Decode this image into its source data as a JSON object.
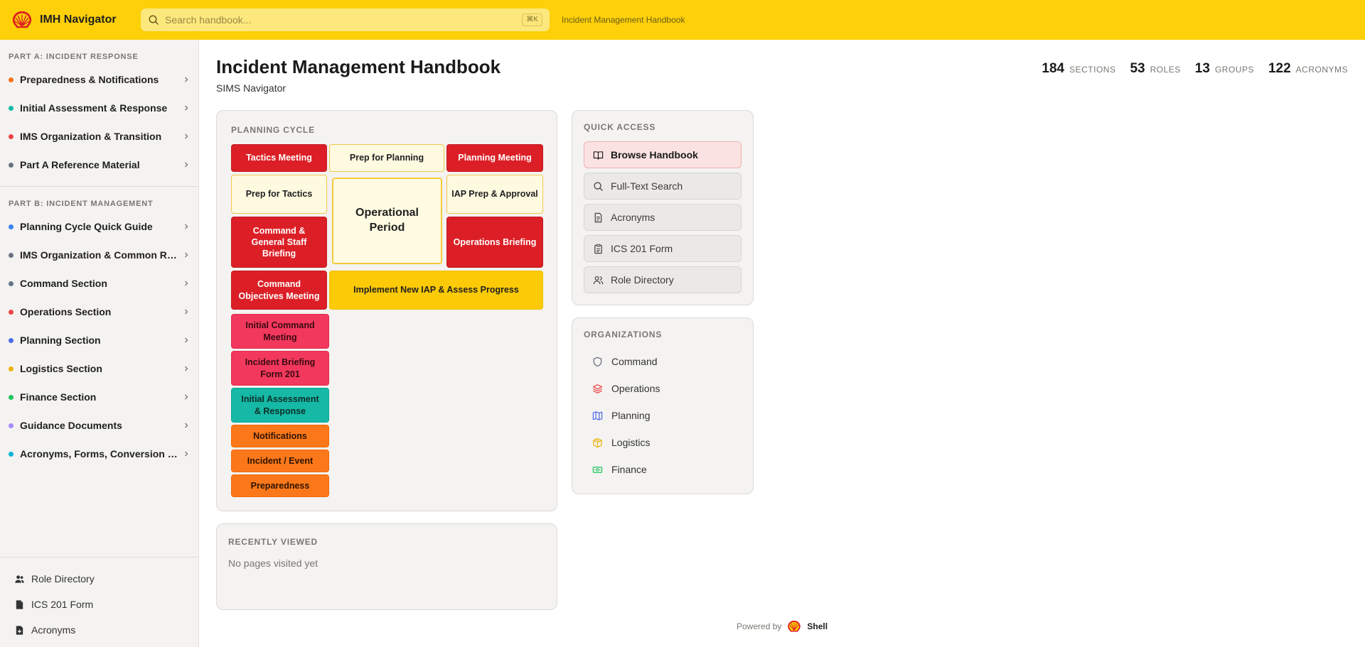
{
  "app": {
    "name": "IMH Navigator",
    "breadcrumb": "Incident Management Handbook"
  },
  "search": {
    "placeholder": "Search handbook...",
    "shortcut": "⌘K"
  },
  "sidebar": {
    "part_a_title": "PART A: INCIDENT RESPONSE",
    "part_a": [
      {
        "label": "Preparedness & Notifications",
        "color": "#f97316"
      },
      {
        "label": "Initial Assessment & Response",
        "color": "#14b8a6"
      },
      {
        "label": "IMS Organization & Transition",
        "color": "#ef4444"
      },
      {
        "label": "Part A Reference Material",
        "color": "#6b7280"
      }
    ],
    "part_b_title": "PART B: INCIDENT MANAGEMENT",
    "part_b": [
      {
        "label": "Planning Cycle Quick Guide",
        "color": "#3b82f6"
      },
      {
        "label": "IMS Organization & Common Re...",
        "color": "#6b7280"
      },
      {
        "label": "Command Section",
        "color": "#64748b"
      },
      {
        "label": "Operations Section",
        "color": "#ef4444"
      },
      {
        "label": "Planning Section",
        "color": "#4f6bed"
      },
      {
        "label": "Logistics Section",
        "color": "#eab308"
      },
      {
        "label": "Finance Section",
        "color": "#22c55e"
      },
      {
        "label": "Guidance Documents",
        "color": "#a78bfa"
      },
      {
        "label": "Acronyms, Forms, Conversion Ta...",
        "color": "#06b6d4"
      }
    ],
    "bottom": [
      {
        "label": "Role Directory",
        "icon": "users-icon"
      },
      {
        "label": "ICS 201 Form",
        "icon": "document-icon"
      },
      {
        "label": "Acronyms",
        "icon": "file-plus-icon"
      }
    ]
  },
  "header": {
    "title": "Incident Management Handbook",
    "subtitle": "SIMS Navigator",
    "stats": [
      {
        "value": "184",
        "label": "SECTIONS"
      },
      {
        "value": "53",
        "label": "ROLES"
      },
      {
        "value": "13",
        "label": "GROUPS"
      },
      {
        "value": "122",
        "label": "ACRONYMS"
      }
    ]
  },
  "planning_cycle": {
    "title": "PLANNING CYCLE",
    "tactics_meeting": "Tactics Meeting",
    "prep_for_planning": "Prep for Planning",
    "planning_meeting": "Planning Meeting",
    "prep_for_tactics": "Prep for Tactics",
    "operational_period": "Operational Period",
    "iap_prep": "IAP Prep & Approval",
    "cgs_briefing": "Command & General Staff Briefing",
    "operations_briefing": "Operations Briefing",
    "command_objectives": "Command Objectives Meeting",
    "implement_iap": "Implement New IAP & Assess Progress",
    "initial_command": "Initial Command Meeting",
    "incident_briefing": "Incident Briefing Form 201",
    "initial_assessment": "Initial Assessment & Response",
    "notifications": "Notifications",
    "incident_event": "Incident / Event",
    "preparedness": "Preparedness"
  },
  "recently_viewed": {
    "title": "RECENTLY VIEWED",
    "empty": "No pages visited yet"
  },
  "quick_access": {
    "title": "QUICK ACCESS",
    "items": [
      {
        "label": "Browse Handbook",
        "icon": "book-open-icon"
      },
      {
        "label": "Full-Text Search",
        "icon": "search-icon"
      },
      {
        "label": "Acronyms",
        "icon": "file-text-icon"
      },
      {
        "label": "ICS 201 Form",
        "icon": "clipboard-icon"
      },
      {
        "label": "Role Directory",
        "icon": "users-icon"
      }
    ]
  },
  "organizations": {
    "title": "ORGANIZATIONS",
    "items": [
      {
        "label": "Command",
        "icon": "shield-icon",
        "color": "#6b7280"
      },
      {
        "label": "Operations",
        "icon": "layers-icon",
        "color": "#ef4444"
      },
      {
        "label": "Planning",
        "icon": "map-icon",
        "color": "#4f6bed"
      },
      {
        "label": "Logistics",
        "icon": "package-icon",
        "color": "#eab308"
      },
      {
        "label": "Finance",
        "icon": "banknote-icon",
        "color": "#22c55e"
      }
    ]
  },
  "footer": {
    "powered_by": "Powered by",
    "brand": "Shell"
  },
  "colors": {
    "topbar": "#fdd009",
    "primary_red": "#dc1f26"
  }
}
